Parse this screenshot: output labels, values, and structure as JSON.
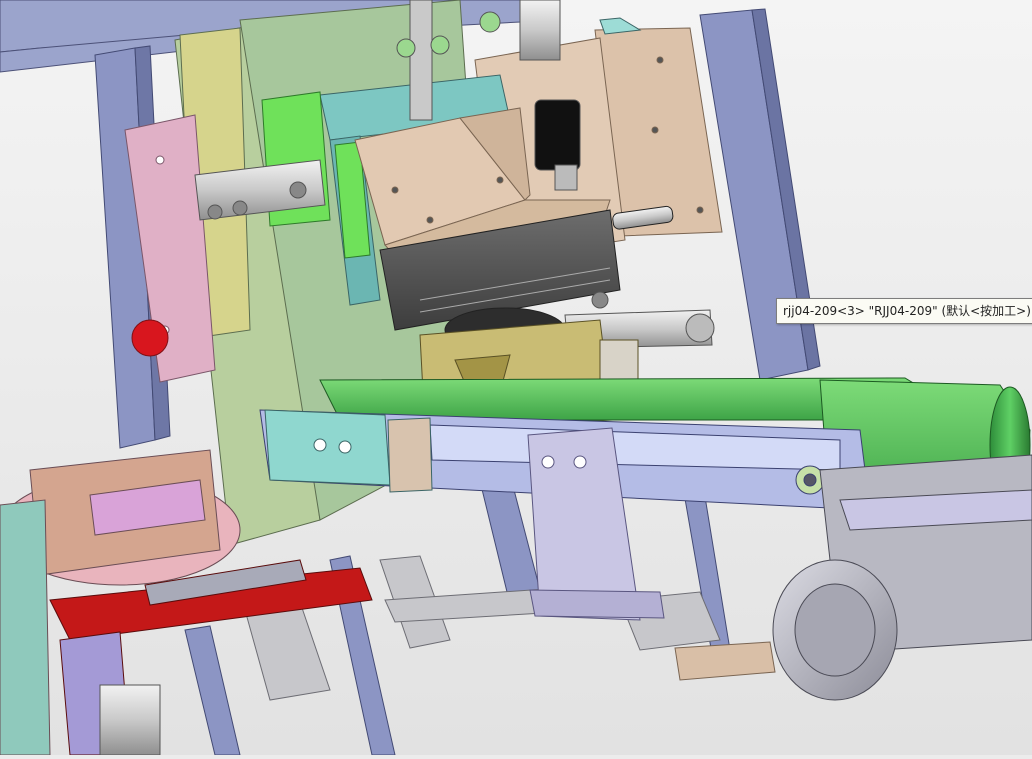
{
  "viewport": {
    "kind": "cad-3d-model-view"
  },
  "tooltip": {
    "text": "rjj04-209<3> \"RJJ04-209\" (默认<按加工>)"
  },
  "colors": {
    "background": "#ececec",
    "frame_blue": "#8c95c4",
    "plate_green": "#a7c79c",
    "conveyor_belt": "#55c25e",
    "red_bracket": "#c41818",
    "tan_block": "#d9bfa7",
    "olive_block": "#c9bc74",
    "motor_grey": "#b8b8c2"
  }
}
